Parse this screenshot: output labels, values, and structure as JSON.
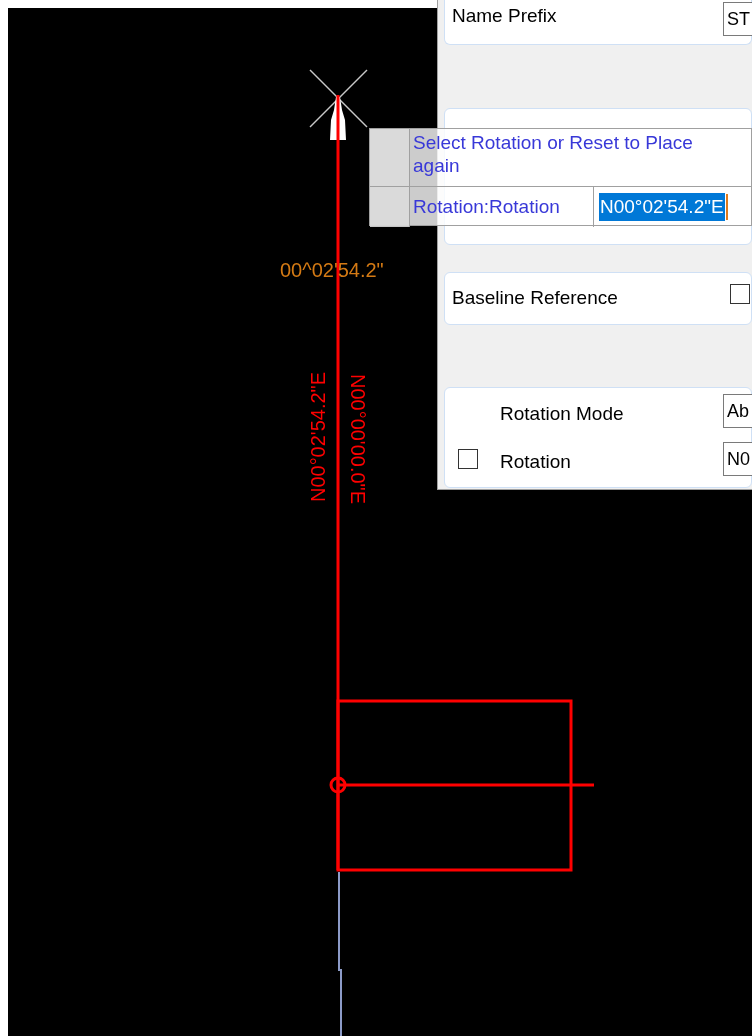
{
  "canvas": {
    "angle_label": "00^02'54.2\"",
    "bearing_labels": [
      {
        "text": "N00°02'54.2\"E",
        "kind": "up"
      },
      {
        "text": "N00°00'00.0\"E",
        "kind": "down"
      }
    ]
  },
  "panel": {
    "name_prefix": {
      "label": "Name Prefix",
      "value": "ST"
    },
    "baseline_reference": {
      "label": "Baseline Reference",
      "checked": false
    },
    "rotation_mode": {
      "label": "Rotation Mode",
      "value": "Ab"
    },
    "rotation": {
      "label": "Rotation",
      "checked": false,
      "value": "N0"
    }
  },
  "prompt": {
    "message": "Select Rotation or Reset to Place again",
    "field_label": "Rotation:Rotation",
    "field_value": "N00°02'54.2\"E",
    "selected": true
  }
}
